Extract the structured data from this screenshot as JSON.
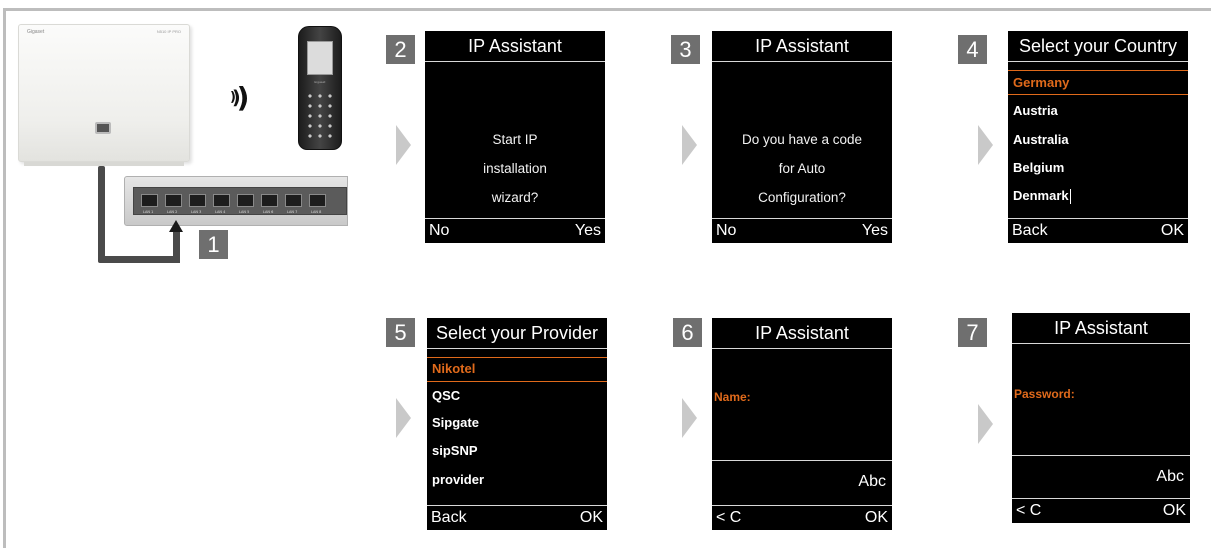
{
  "steps": {
    "s1": "1",
    "s2": "2",
    "s3": "3",
    "s4": "4",
    "s5": "5",
    "s6": "6",
    "s7": "7"
  },
  "hardware": {
    "base_brand": "Gigaset",
    "base_model": "N510 IP PRO",
    "handset_brand": "Gigaset",
    "port_labels": [
      "LAN 1",
      "LAN 2",
      "LAN 3",
      "LAN 4",
      "LAN 5",
      "LAN 6",
      "LAN 7",
      "LAN 8"
    ]
  },
  "screen2": {
    "title": "IP Assistant",
    "lines": [
      "Start IP",
      "installation",
      "wizard?"
    ],
    "left_soft": "No",
    "right_soft": "Yes"
  },
  "screen3": {
    "title": "IP Assistant",
    "lines": [
      "Do you have a code",
      "for Auto",
      "Configuration?"
    ],
    "left_soft": "No",
    "right_soft": "Yes"
  },
  "screen4": {
    "title": "Select your Country",
    "items": [
      "Germany",
      "Austria",
      "Australia",
      "Belgium",
      "Denmark"
    ],
    "left_soft": "Back",
    "right_soft": "OK"
  },
  "screen5": {
    "title": "Select your Provider",
    "items": [
      "Nikotel",
      "QSC",
      "Sipgate",
      "sipSNP",
      "provider"
    ],
    "left_soft": "Back",
    "right_soft": "OK"
  },
  "screen6": {
    "title": "IP Assistant",
    "field_label": "Name:",
    "input_mode": "Abc",
    "left_soft": "< C",
    "right_soft": "OK"
  },
  "screen7": {
    "title": "IP Assistant",
    "field_label": "Password:",
    "input_mode": "Abc",
    "left_soft": "< C",
    "right_soft": "OK"
  },
  "colors": {
    "highlight": "#e06a1b",
    "badge": "#6f6f6f",
    "screen_bg": "#000000",
    "frame": "#bdbdbd"
  }
}
